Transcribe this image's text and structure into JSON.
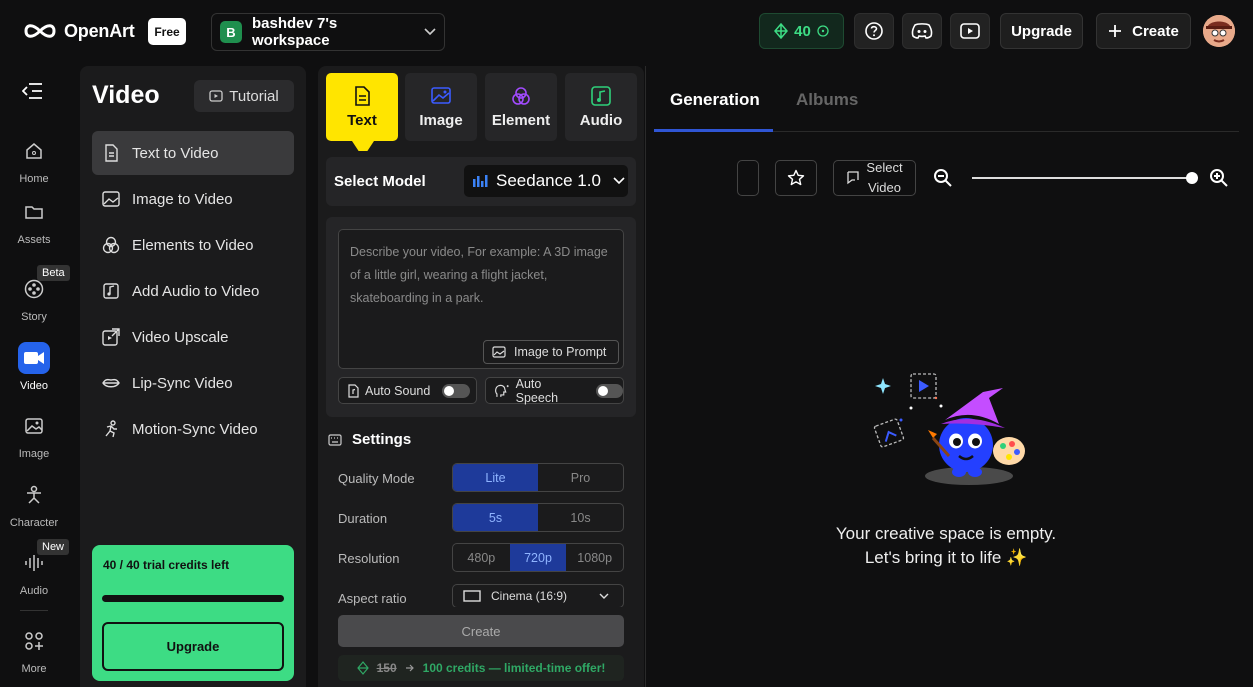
{
  "header": {
    "logo_text": "OpenArt",
    "plan_badge": "Free",
    "workspace_initial": "B",
    "workspace_name": "bashdev 7's workspace",
    "credits": "40",
    "upgrade_label": "Upgrade",
    "create_label": "Create"
  },
  "rail": {
    "items": [
      {
        "label": "Home",
        "icon": "home-icon"
      },
      {
        "label": "Assets",
        "icon": "folder-icon"
      },
      {
        "label": "Story",
        "icon": "film-reel-icon",
        "badge": "Beta"
      },
      {
        "label": "Video",
        "icon": "video-camera-icon"
      },
      {
        "label": "Image",
        "icon": "image-icon"
      },
      {
        "label": "Character",
        "icon": "character-icon"
      },
      {
        "label": "Audio",
        "icon": "audio-wave-icon",
        "badge": "New"
      },
      {
        "label": "More",
        "icon": "grid-more-icon"
      }
    ]
  },
  "video_panel": {
    "title": "Video",
    "tutorial_label": "Tutorial",
    "items": [
      {
        "label": "Text to Video",
        "active": true
      },
      {
        "label": "Image to Video"
      },
      {
        "label": "Elements to Video"
      },
      {
        "label": "Add Audio to Video"
      },
      {
        "label": "Video Upscale"
      },
      {
        "label": "Lip-Sync Video"
      },
      {
        "label": "Motion-Sync Video"
      }
    ],
    "trial_text": "40 / 40 trial credits left",
    "trial_progress": 1.0,
    "trial_upgrade": "Upgrade"
  },
  "generator": {
    "tabs": [
      {
        "label": "Text",
        "active": true
      },
      {
        "label": "Image"
      },
      {
        "label": "Element"
      },
      {
        "label": "Audio"
      }
    ],
    "model_label": "Select Model",
    "model_value": "Seedance 1.0",
    "prompt_placeholder": "Describe your video, For example: A 3D image of a little girl, wearing a flight jacket, skateboarding in a park.",
    "image_to_prompt": "Image to Prompt",
    "auto_sound": "Auto Sound",
    "auto_speech": "Auto Speech",
    "settings_title": "Settings",
    "quality_label": "Quality Mode",
    "quality_options": [
      "Lite",
      "Pro"
    ],
    "quality_selected": "Lite",
    "duration_label": "Duration",
    "duration_options": [
      "5s",
      "10s"
    ],
    "duration_selected": "5s",
    "resolution_label": "Resolution",
    "resolution_options": [
      "480p",
      "720p",
      "1080p"
    ],
    "resolution_selected": "720p",
    "aspect_label": "Aspect ratio",
    "aspect_value": "Cinema (16:9)",
    "create_label": "Create",
    "offer_old": "150",
    "offer_new": "100 credits — limited-time offer!"
  },
  "results": {
    "tab_generation": "Generation",
    "tab_albums": "Albums",
    "select_video_line1": "Select",
    "select_video_line2": "Video",
    "zoom_level": 1.0,
    "empty_line1": "Your creative space is empty.",
    "empty_line2": "Let's bring it to life ✨"
  },
  "colors": {
    "accent_yellow": "#ffe500",
    "accent_green": "#3ddc84",
    "accent_blue": "#2563eb"
  }
}
